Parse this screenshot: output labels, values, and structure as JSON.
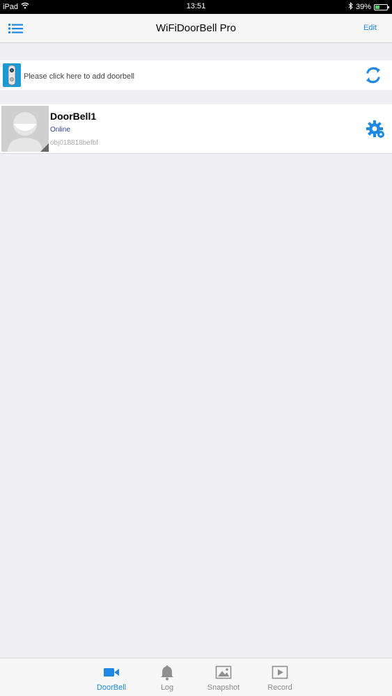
{
  "status_bar": {
    "device": "iPad",
    "time": "13:51",
    "battery": "39%",
    "battery_level": 0.39
  },
  "nav": {
    "title": "WiFiDoorBell Pro",
    "edit_label": "Edit"
  },
  "add_doorbell": {
    "text": "Please click here to add doorbell"
  },
  "devices": [
    {
      "name": "DoorBell1",
      "status": "Online",
      "uid": "obj018818befbf"
    }
  ],
  "tabs": [
    {
      "label": "DoorBell",
      "icon": "video-camera-icon",
      "active": true
    },
    {
      "label": "Log",
      "icon": "bell-icon",
      "active": false
    },
    {
      "label": "Snapshot",
      "icon": "image-icon",
      "active": false
    },
    {
      "label": "Record",
      "icon": "play-icon",
      "active": false
    }
  ],
  "colors": {
    "accent": "#1e88e5",
    "background": "#efeff4",
    "status_online": "#2c3f8a"
  }
}
